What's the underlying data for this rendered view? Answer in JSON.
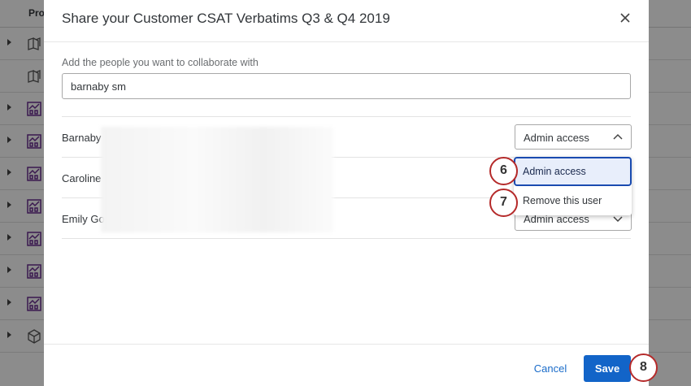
{
  "background": {
    "column_header": "Proj",
    "rows": [
      {
        "icon": "survey-icon"
      },
      {
        "icon": "survey-icon"
      },
      {
        "icon": "dashboard-icon"
      },
      {
        "icon": "dashboard-icon"
      },
      {
        "icon": "dashboard-icon"
      },
      {
        "icon": "dashboard-icon"
      },
      {
        "icon": "dashboard-icon"
      },
      {
        "icon": "dashboard-icon"
      },
      {
        "icon": "dashboard-icon"
      },
      {
        "icon": "cube-icon"
      }
    ]
  },
  "dialog": {
    "title": "Share your Customer CSAT Verbatims Q3 & Q4 2019",
    "add_label": "Add the people you want to collaborate with",
    "search_value": "barnaby sm",
    "users": [
      {
        "name": "Barnaby",
        "access": "Admin access"
      },
      {
        "name": "Caroline",
        "access": "Admin access"
      },
      {
        "name": "Emily Go",
        "access": "Admin access"
      }
    ],
    "menu": {
      "items": [
        "Admin access",
        "Remove this user"
      ],
      "selected": "Admin access"
    },
    "cancel_label": "Cancel",
    "save_label": "Save"
  },
  "steps": [
    "6",
    "7",
    "8"
  ],
  "colors": {
    "primary": "#1264c8",
    "link": "#1a6cc9",
    "callout_border": "#b52a2a",
    "icon_purple": "#6b2c91"
  }
}
